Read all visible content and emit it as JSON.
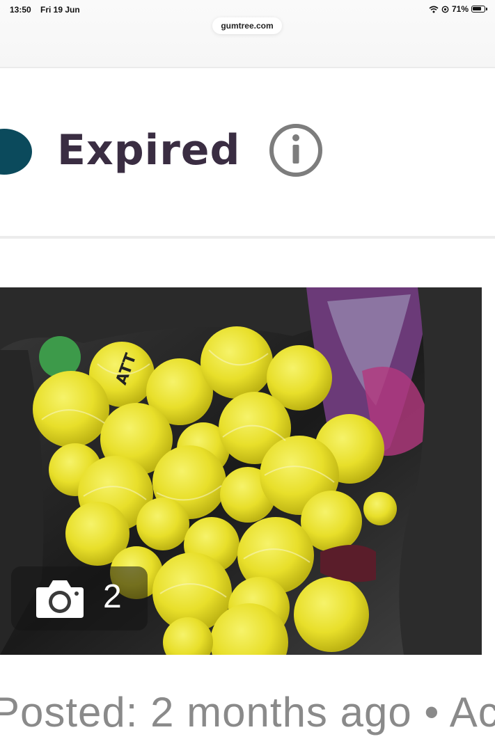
{
  "status_bar": {
    "time": "13:50",
    "date": "Fri 19 Jun",
    "battery": "71%"
  },
  "browser": {
    "url": "gumtree.com"
  },
  "listing": {
    "status_label": "Expired",
    "status_color": "#0b4a5c",
    "photo_count": "2",
    "posted_text": "Posted: 2 months ago • Ac"
  },
  "icons": {
    "wifi": "wifi-icon",
    "location": "location-icon",
    "battery": "battery-icon",
    "info": "info-icon",
    "camera": "camera-icon"
  }
}
